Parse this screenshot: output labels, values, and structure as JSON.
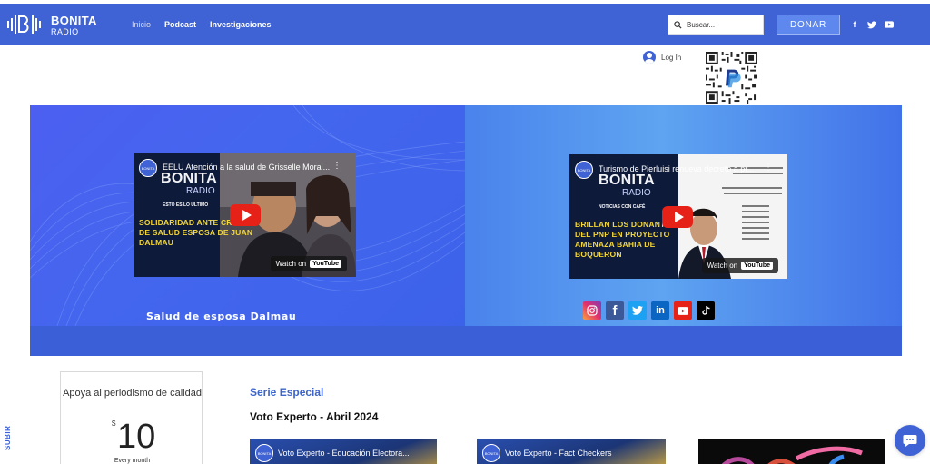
{
  "header": {
    "logo_name": "BONITA",
    "logo_sub": "RADIO",
    "nav": [
      "Inicio",
      "Podcast",
      "Investigaciones"
    ],
    "search_placeholder": "Buscar...",
    "donate_label": "DONAR",
    "social": [
      "facebook-icon",
      "twitter-icon",
      "youtube-icon"
    ],
    "bg_color": "#3f62d4"
  },
  "login": {
    "label": "Log In"
  },
  "hero": {
    "left_video": {
      "title": "EELU Atención a la salud de Grisselle Moral...",
      "brand": "BONITA",
      "brand_sub": "RADIO",
      "kicker": "ESTO ES LO ÚLTIMO",
      "headline": "SOLIDARIDAD ANTE CRISIS DE SALUD ESPOSA DE JUAN DALMAU",
      "watch_on": "Watch on",
      "yt": "YouTube"
    },
    "right_video": {
      "title": "Turismo de Pierluisi renueva decreto a pr...",
      "brand": "BONITA",
      "brand_sub": "RADIO",
      "kicker": "NOTICIAS CON CAFÉ",
      "headline": "BRILLAN LOS DONANTES DEL PNP EN PROYECTO AMENAZA BAHIA DE BOQUERON",
      "watch_on": "Watch on",
      "yt": "YouTube"
    },
    "caption": "Salud de esposa Dalmau",
    "social_row": [
      "instagram-icon",
      "facebook-icon",
      "twitter-icon",
      "linkedin-icon",
      "youtube-icon",
      "tiktok-icon"
    ]
  },
  "support_card": {
    "title": "Apoya al periodismo de calidad",
    "currency": "$",
    "amount": "10",
    "frequency": "Every month"
  },
  "subir": "SUBIR",
  "section": {
    "label": "Serie Especial",
    "title": "Voto Experto - Abril 2024",
    "videos": [
      {
        "title": "Voto Experto - Educación Electora..."
      },
      {
        "title": "Voto Experto - Fact Checkers"
      }
    ]
  }
}
